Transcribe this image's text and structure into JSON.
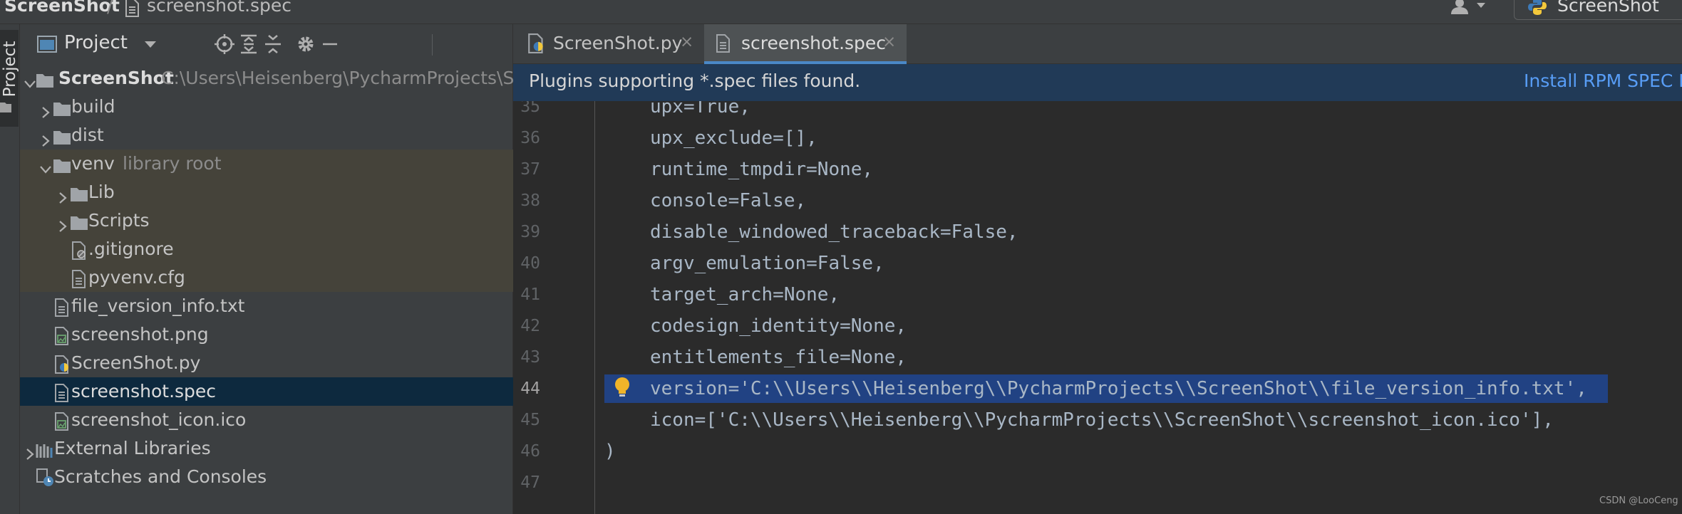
{
  "breadcrumb": {
    "project": "ScreenShot",
    "separator": "/",
    "file": "screenshot.spec"
  },
  "run_config": {
    "label": "ScreenShot",
    "icon": "python-icon"
  },
  "left_strip": {
    "label": "Project"
  },
  "project_panel": {
    "title": "Project",
    "header_icons": [
      "locate-icon",
      "expand-all-icon",
      "collapse-all-icon",
      "gear-icon",
      "minimize-icon"
    ],
    "tree": [
      {
        "label": "ScreenShot",
        "path": "C:\\Users\\Heisenberg\\PycharmProjects\\S",
        "icon": "folder-icon",
        "expanded": true,
        "depth": 0
      },
      {
        "label": "build",
        "icon": "folder-icon",
        "expanded": false,
        "depth": 1
      },
      {
        "label": "dist",
        "icon": "folder-icon",
        "expanded": false,
        "depth": 1
      },
      {
        "label": "venv",
        "path": "library root",
        "icon": "folder-icon",
        "expanded": true,
        "depth": 1
      },
      {
        "label": "Lib",
        "icon": "folder-icon",
        "expanded": false,
        "depth": 2
      },
      {
        "label": "Scripts",
        "icon": "folder-icon",
        "expanded": false,
        "depth": 2
      },
      {
        "label": ".gitignore",
        "icon": "gitignore-file-icon",
        "depth": 2
      },
      {
        "label": "pyvenv.cfg",
        "icon": "config-file-icon",
        "depth": 2
      },
      {
        "label": "file_version_info.txt",
        "icon": "text-file-icon",
        "depth": 1
      },
      {
        "label": "screenshot.png",
        "icon": "image-file-icon",
        "depth": 1
      },
      {
        "label": "ScreenShot.py",
        "icon": "python-file-icon",
        "depth": 1
      },
      {
        "label": "screenshot.spec",
        "icon": "spec-file-icon",
        "depth": 1
      },
      {
        "label": "screenshot_icon.ico",
        "icon": "image-file-icon",
        "depth": 1
      },
      {
        "label": "External Libraries",
        "icon": "library-icon",
        "expanded": false,
        "depth": 0
      },
      {
        "label": "Scratches and Consoles",
        "icon": "scratches-icon",
        "depth": 0
      }
    ]
  },
  "tabs": [
    {
      "label": "ScreenShot.py",
      "icon": "python-file-icon",
      "close": "×"
    },
    {
      "label": "screenshot.spec",
      "icon": "spec-file-icon",
      "close": "×",
      "active": true
    }
  ],
  "banner": {
    "message": "Plugins supporting *.spec files found.",
    "link": "Install RPM SPEC Fi"
  },
  "code_lines": [
    {
      "n": "35",
      "text": "upx=True,"
    },
    {
      "n": "36",
      "text": "upx_exclude=[],"
    },
    {
      "n": "37",
      "text": "runtime_tmpdir=None,"
    },
    {
      "n": "38",
      "text": "console=False,"
    },
    {
      "n": "39",
      "text": "disable_windowed_traceback=False,"
    },
    {
      "n": "40",
      "text": "argv_emulation=False,"
    },
    {
      "n": "41",
      "text": "target_arch=None,"
    },
    {
      "n": "42",
      "text": "codesign_identity=None,"
    },
    {
      "n": "43",
      "text": "entitlements_file=None,"
    },
    {
      "n": "44",
      "text": "version='C:\\\\Users\\\\Heisenberg\\\\PycharmProjects\\\\ScreenShot\\\\file_version_info.txt',",
      "highlight": true
    },
    {
      "n": "45",
      "text": "icon=['C:\\\\Users\\\\Heisenberg\\\\PycharmProjects\\\\ScreenShot\\\\screenshot_icon.ico'],"
    },
    {
      "n": "46",
      "text": ")"
    },
    {
      "n": "47",
      "text": ""
    }
  ],
  "watermark": "CSDN @LooCeng",
  "colors": {
    "panel_bg": "#3c3f41",
    "editor_bg": "#2b2b2b",
    "selection": "#214283",
    "tree_selected": "#0d293e",
    "library_root_bg": "#45433a",
    "banner_bg": "#213a57",
    "link": "#589df6"
  }
}
